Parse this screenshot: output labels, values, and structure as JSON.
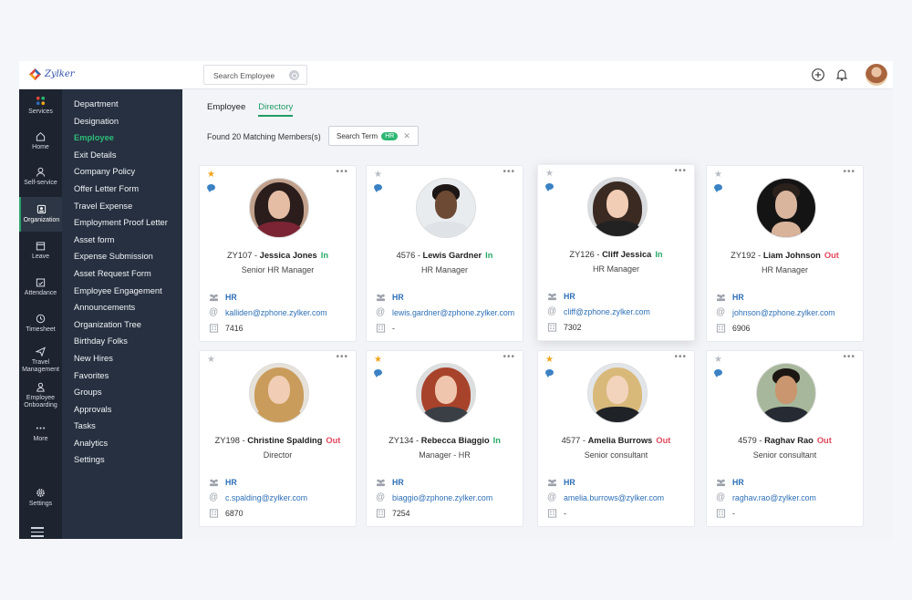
{
  "app": {
    "logo_text": "Zylker"
  },
  "search": {
    "placeholder": "Search Employee"
  },
  "rail": {
    "items": [
      {
        "label": "Services",
        "icon": "grid-icon"
      },
      {
        "label": "Home",
        "icon": "home-icon"
      },
      {
        "label": "Self-service",
        "icon": "user-icon"
      },
      {
        "label": "Organization",
        "icon": "organization-icon"
      },
      {
        "label": "Leave",
        "icon": "calendar-icon"
      },
      {
        "label": "Attendance",
        "icon": "calendar-check-icon"
      },
      {
        "label": "Timesheet",
        "icon": "clock-icon"
      },
      {
        "label": "Travel Management",
        "icon": "plane-icon"
      },
      {
        "label": "Employee Onboarding",
        "icon": "onboarding-icon"
      },
      {
        "label": "More",
        "icon": "more-icon"
      },
      {
        "label": "Settings",
        "icon": "gear-icon"
      }
    ]
  },
  "subnav": {
    "items": [
      "Department",
      "Designation",
      "Employee",
      "Exit Details",
      "Company Policy",
      "Offer Letter Form",
      "Travel Expense",
      "Employment Proof Letter",
      "Asset form",
      "Expense Submission",
      "Asset Request Form",
      "Employee Engagement",
      "Announcements",
      "Organization Tree",
      "Birthday Folks",
      "New Hires",
      "Favorites",
      "Groups",
      "Approvals",
      "Tasks",
      "Analytics",
      "Settings"
    ],
    "active": "Employee"
  },
  "tabs": [
    {
      "label": "Employee",
      "active": false
    },
    {
      "label": "Directory",
      "active": true
    }
  ],
  "results": {
    "found_text": "Found 20 Matching Members(s)",
    "chip_label": "Search Term",
    "chip_tag": "HR"
  },
  "colors": {
    "accent": "#1f9b63",
    "link": "#2d6fb6",
    "status_in": "#27a866",
    "status_out": "#e0475b",
    "star": "#f2a51e",
    "sidebar": "#263040",
    "rail": "#1d2430"
  },
  "employees": [
    {
      "id": "ZY107",
      "name": "Jessica Jones",
      "status": "In",
      "role": "Senior HR Manager",
      "dept": "HR",
      "email": "kalliden@zphone.zylker.com",
      "ext": "7416",
      "starred": true
    },
    {
      "id": "4576",
      "name": "Lewis Gardner",
      "status": "In",
      "role": "HR Manager",
      "dept": "HR",
      "email": "lewis.gardner@zphone.zylker.com",
      "ext": "-",
      "starred": false
    },
    {
      "id": "ZY126",
      "name": "Cliff Jessica",
      "status": "In",
      "role": "HR Manager",
      "dept": "HR",
      "email": "cliff@zphone.zylker.com",
      "ext": "7302",
      "starred": false
    },
    {
      "id": "ZY192",
      "name": "Liam Johnson",
      "status": "Out",
      "role": "HR Manager",
      "dept": "HR",
      "email": "johnson@zphone.zylker.com",
      "ext": "6906",
      "starred": false
    },
    {
      "id": "ZY198",
      "name": "Christine Spalding",
      "status": "Out",
      "role": "Director",
      "dept": "HR",
      "email": "c.spalding@zylker.com",
      "ext": "6870",
      "starred": false
    },
    {
      "id": "ZY134",
      "name": "Rebecca Biaggio",
      "status": "In",
      "role": "Manager - HR",
      "dept": "HR",
      "email": "biaggio@zphone.zylker.com",
      "ext": "7254",
      "starred": true
    },
    {
      "id": "4577",
      "name": "Amelia Burrows",
      "status": "Out",
      "role": "Senior consultant",
      "dept": "HR",
      "email": "amelia.burrows@zylker.com",
      "ext": "-",
      "starred": true
    },
    {
      "id": "4579",
      "name": "Raghav Rao",
      "status": "Out",
      "role": "Senior consultant",
      "dept": "HR",
      "email": "raghav.rao@zylker.com",
      "ext": "-",
      "starred": false
    }
  ]
}
